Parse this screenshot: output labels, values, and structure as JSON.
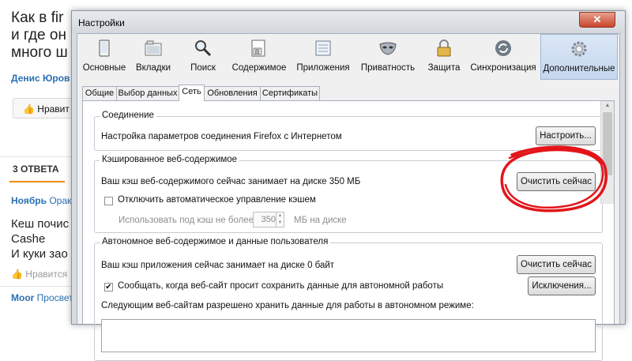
{
  "background_page": {
    "title": "Как в fir\nи где он\nмного ш",
    "author": "Денис Юров",
    "like_button": "Нравит",
    "answers_count": "3 ОТВЕТА",
    "answer_user": "Ноябрь",
    "answer_user_suffix": "Орак",
    "answer_text": "Кеш почис\nCashe\nИ куки зао",
    "answer_like": "Нравится",
    "second_user": "Moor",
    "second_user_suffix": "Просвет"
  },
  "window": {
    "title": "Настройки",
    "close_symbol": "✕"
  },
  "toolbar": {
    "items": [
      {
        "label": "Основные",
        "icon": "general-icon"
      },
      {
        "label": "Вкладки",
        "icon": "tabs-icon"
      },
      {
        "label": "Поиск",
        "icon": "search-icon"
      },
      {
        "label": "Содержимое",
        "icon": "content-icon"
      },
      {
        "label": "Приложения",
        "icon": "applications-icon"
      },
      {
        "label": "Приватность",
        "icon": "privacy-mask-icon"
      },
      {
        "label": "Защита",
        "icon": "security-lock-icon"
      },
      {
        "label": "Синхронизация",
        "icon": "sync-icon"
      },
      {
        "label": "Дополнительные",
        "icon": "advanced-gear-icon",
        "selected": true
      }
    ]
  },
  "tabs": [
    {
      "label": "Общие"
    },
    {
      "label": "Выбор данных"
    },
    {
      "label": "Сеть",
      "active": true
    },
    {
      "label": "Обновления"
    },
    {
      "label": "Сертификаты"
    }
  ],
  "connection": {
    "title": "Соединение",
    "description": "Настройка параметров соединения Firefox с Интернетом",
    "configure_button": "Настроить..."
  },
  "cache": {
    "title": "Кэшированное веб-содержимое",
    "usage_text": "Ваш кэш веб-содержимого сейчас занимает на диске 350 МБ",
    "clear_button": "Очистить сейчас",
    "override_checkbox_label": "Отключить автоматическое управление кэшем",
    "override_checked": false,
    "limit_label": "Использовать под кэш не более",
    "limit_value": "350",
    "limit_unit": "МБ на диске"
  },
  "offline": {
    "title": "Автономное веб-содержимое и данные пользователя",
    "usage_text": "Ваш кэш приложения сейчас занимает на диске 0 байт",
    "clear_button": "Очистить сейчас",
    "notify_checkbox_label": "Сообщать, когда веб-сайт просит сохранить данные для автономной работы",
    "notify_checked": true,
    "exceptions_button": "Исключения...",
    "allowed_sites_label": "Следующим веб-сайтам разрешено хранить данные для работы в автономном режиме:"
  },
  "colors": {
    "annotation": "#e3151a",
    "link": "#2a6fb3",
    "answers_underline": "#f08a00"
  }
}
